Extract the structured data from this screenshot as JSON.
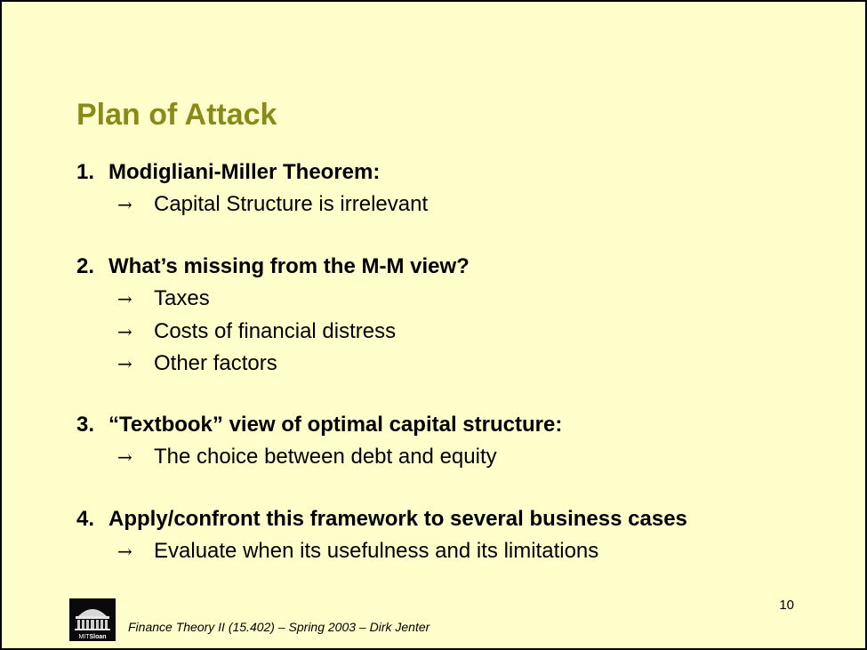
{
  "slide": {
    "title": "Plan of Attack",
    "sections": [
      {
        "number": "1.",
        "heading": "Modigliani-Miller Theorem:",
        "bullets": [
          "Capital Structure is irrelevant"
        ]
      },
      {
        "number": "2.",
        "heading": "What’s missing from the M-M view?",
        "bullets": [
          "Taxes",
          "Costs of financial distress",
          "Other factors"
        ]
      },
      {
        "number": "3.",
        "heading": "“Textbook” view of optimal capital structure:",
        "bullets": [
          "The choice between debt and equity"
        ]
      },
      {
        "number": "4.",
        "heading": "Apply/confront this framework to several business cases",
        "bullets": [
          "Evaluate when its usefulness and its limitations"
        ]
      }
    ],
    "bullet_symbol": "→",
    "page_number": "10",
    "footer": "Finance Theory II (15.402) – Spring 2003 – Dirk Jenter",
    "logo_text": "MITSloan"
  },
  "colors": {
    "background": "#ffffcc",
    "title": "#8a8a1a",
    "text": "#000000"
  },
  "icons": {
    "logo": "mit-sloan-dome-logo-icon",
    "bullet": "right-arrow-icon"
  }
}
